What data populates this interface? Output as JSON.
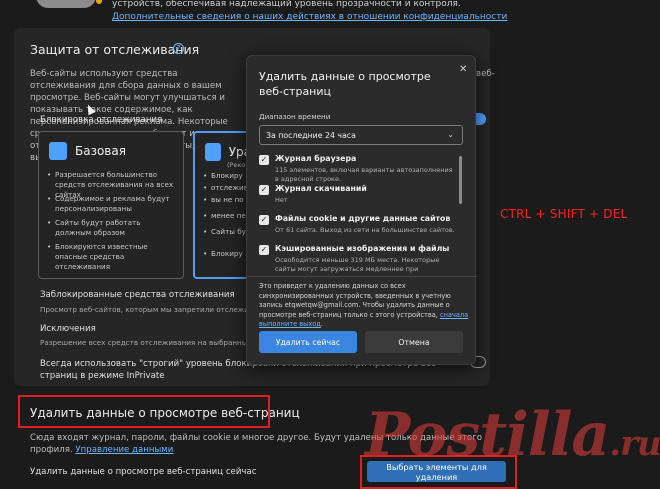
{
  "top": {
    "text": "устройств, обеспечивая надлежащий уровень прозрачности и контроля.",
    "link": "Дополнительные сведения о наших действиях в отношении конфиденциальности"
  },
  "tracking": {
    "title": "Защита от отслеживания",
    "desc": "Веб-сайты используют средства отслеживания для сбора данных о вашем просмотре. Веб-сайты могут улучшаться и показывать такое содержимое, как персонализированная реклама. Некоторые средства отслеживания собирают и отправляют ваши данные на сайты, которые вы не посещали.",
    "desc_right": "веб-",
    "block_label": "Блокировка отслеживания",
    "basic": {
      "title": "Базовая",
      "bullets": [
        "Разрешается большинство средств отслеживания на всех сайтах",
        "Содержимое и реклама будут персонализированы",
        "Сайты будут работать должным образом",
        "Блокируются известные опасные средства отслеживания"
      ]
    },
    "balanced": {
      "title": "Ура",
      "sub": "(Реком",
      "bullets": [
        "Блокиру",
        "отслежив",
        "вы не по",
        "менее пер",
        "Сайты бу",
        "Блокиру"
      ]
    },
    "blocked": {
      "title": "Заблокированные средства отслеживания",
      "sub": "Просмотр веб-сайтов, которым мы запретили отслеживание"
    },
    "exceptions": {
      "title": "Исключения",
      "sub": "Разрешение всех средств отслеживания на выбранных сайтах"
    },
    "strict": {
      "title": "Всегда использовать \"строгий\" уровень блокировки отслеживания при просмотре веб-страниц в режиме InPrivate"
    }
  },
  "delete": {
    "title": "Удалить данные о просмотре веб-страниц",
    "desc": "Сюда входят журнал, пароли, файлы cookie и многое другое. Будут удалены только данные этого профиля.",
    "desc_link": "Управление данными",
    "row_label": "Удалить данные о просмотре веб-страниц сейчас",
    "button": "Выбрать элементы для удаления"
  },
  "shortcut": "CTRL + SHIFT + DEL",
  "watermark": {
    "main": "Postilla",
    "suffix": ".ru"
  },
  "modal": {
    "title": "Удалить данные о просмотре веб-страниц",
    "close": "✕",
    "range_label": "Диапазон времени",
    "range_value": "За последние 24 часа",
    "items": [
      {
        "title": "Журнал браузера",
        "sub": "115 элементов, включая варианты автозаполнения в адресной строке."
      },
      {
        "title": "Журнал скачиваний",
        "sub": "Нет"
      },
      {
        "title": "Файлы cookie и другие данные сайтов",
        "sub": "От 61 сайта. Выход из сети на большинстве сайтов."
      },
      {
        "title": "Кэшированные изображения и файлы",
        "sub": "Освободится меньше 319 МБ места. Некоторые сайты могут загружаться медленнее при следующем посещении."
      }
    ],
    "note": "Это приведет к удалению данных со всех синхронизированных устройств, введенных в учетную запись etqwetqw@gmail.com. Чтобы удалить данные о просмотре веб-страниц только с этого устройства,",
    "note_link": "сначала выполните выход",
    "note_end": ".",
    "primary": "Удалить сейчас",
    "secondary": "Отмена"
  },
  "colors": {
    "accent": "#3a86e0",
    "highlight": "#e02020",
    "background": "#1b1b1b"
  }
}
